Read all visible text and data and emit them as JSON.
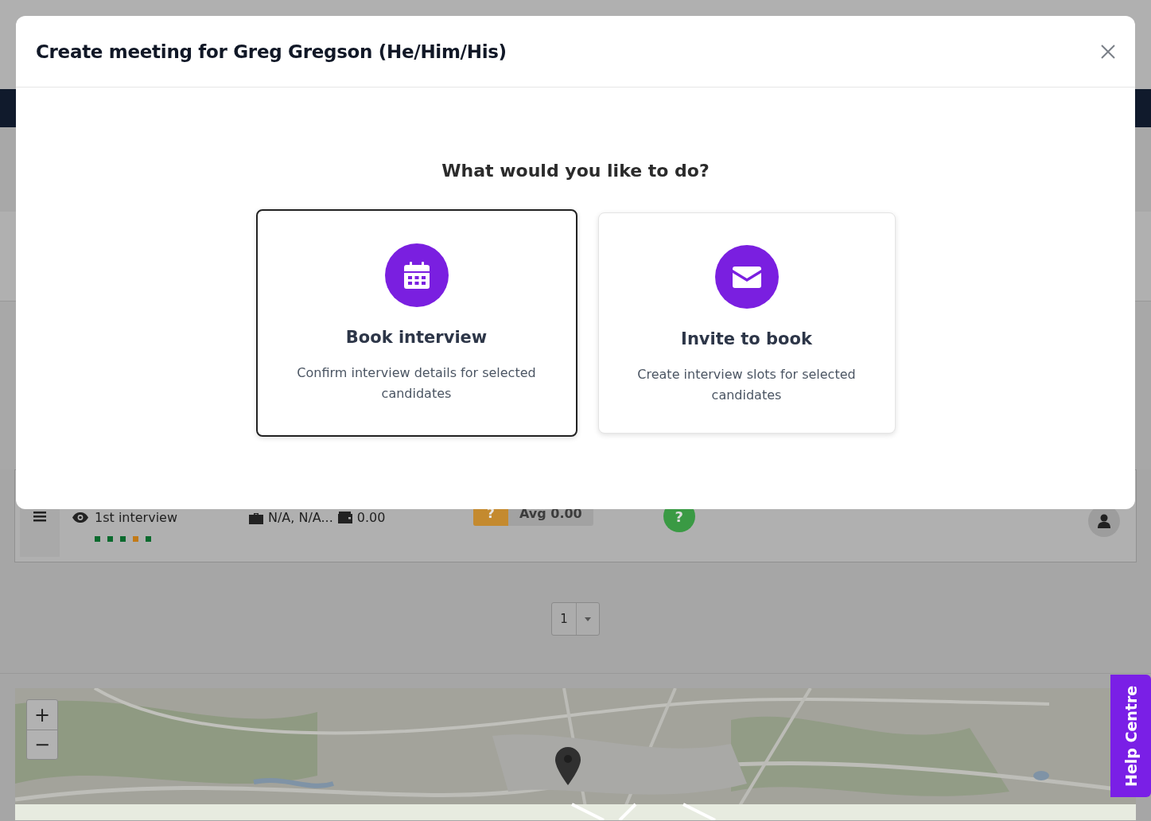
{
  "modal": {
    "title": "Create meeting for Greg Gregson (He/Him/His)",
    "question": "What would you like to do?",
    "options": [
      {
        "kind": "book",
        "title": "Book interview",
        "description": "Confirm interview details for selected candidates",
        "selected": true
      },
      {
        "kind": "invite",
        "title": "Invite to book",
        "description": "Create interview slots for selected candidates",
        "selected": false
      }
    ]
  },
  "candidate_row": {
    "stage": "1st interview",
    "progress": [
      {
        "color": "#0b6a2e"
      },
      {
        "color": "#0b6a2e"
      },
      {
        "color": "#0b6a2e"
      },
      {
        "color": "#c27a17"
      },
      {
        "color": "#0b6a2e"
      }
    ],
    "location": "N/A, N/A...",
    "salary": "0.00",
    "score": "?",
    "average": "Avg 0.00",
    "status": "?"
  },
  "pagination": {
    "page": "1"
  },
  "map": {
    "kind": "picture",
    "zoom_in": "+",
    "zoom_out": "−"
  },
  "help_tab": {
    "label": "Help Centre"
  }
}
